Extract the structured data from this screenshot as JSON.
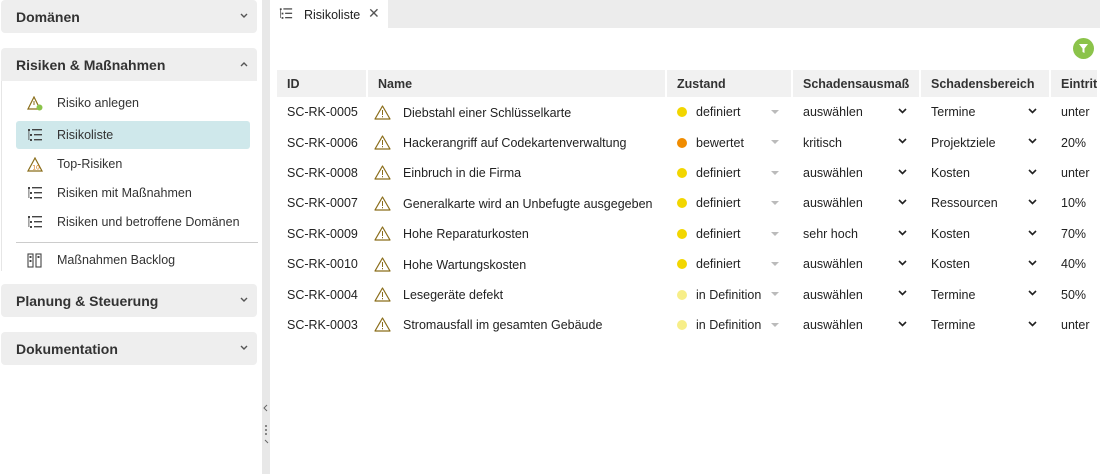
{
  "sidebar": {
    "sections": [
      {
        "label": "Domänen"
      },
      {
        "label": "Risiken & Maßnahmen"
      },
      {
        "label": "Planung & Steuerung"
      },
      {
        "label": "Dokumentation"
      }
    ],
    "items": [
      {
        "label": "Risiko anlegen",
        "icon": "risk-add-icon"
      },
      {
        "label": "Risikoliste",
        "icon": "list-icon"
      },
      {
        "label": "Top-Risiken",
        "icon": "top-risk-icon"
      },
      {
        "label": "Risiken mit Maßnahmen",
        "icon": "list-icon"
      },
      {
        "label": "Risiken und betroffene Domänen",
        "icon": "list-icon"
      },
      {
        "label": "Maßnahmen Backlog",
        "icon": "backlog-icon"
      }
    ]
  },
  "tab": {
    "label": "Risikoliste",
    "close": "✕"
  },
  "table": {
    "headers": [
      "ID",
      "Name",
      "Zustand",
      "Schadensausmaß",
      "Schadensbereich",
      "Eintrit"
    ],
    "rows": [
      {
        "id": "SC-RK-0005",
        "name": "Diebstahl einer Schlüsselkarte",
        "zustand": "definiert",
        "color": "#f2d600",
        "ausmass": "auswählen",
        "bereich": "Termine",
        "eintritt": "unter"
      },
      {
        "id": "SC-RK-0006",
        "name": "Hackerangriff auf Codekartenverwaltung",
        "zustand": "bewertet",
        "color": "#f08c00",
        "ausmass": "kritisch",
        "bereich": "Projektziele",
        "eintritt": "20%"
      },
      {
        "id": "SC-RK-0008",
        "name": "Einbruch in die Firma",
        "zustand": "definiert",
        "color": "#f2d600",
        "ausmass": "auswählen",
        "bereich": "Kosten",
        "eintritt": "unter"
      },
      {
        "id": "SC-RK-0007",
        "name": "Generalkarte wird an Unbefugte ausgegeben",
        "zustand": "definiert",
        "color": "#f2d600",
        "ausmass": "auswählen",
        "bereich": "Ressourcen",
        "eintritt": "10%"
      },
      {
        "id": "SC-RK-0009",
        "name": "Hohe Reparaturkosten",
        "zustand": "definiert",
        "color": "#f2d600",
        "ausmass": "sehr hoch",
        "bereich": "Kosten",
        "eintritt": "70%"
      },
      {
        "id": "SC-RK-0010",
        "name": "Hohe Wartungskosten",
        "zustand": "definiert",
        "color": "#f2d600",
        "ausmass": "auswählen",
        "bereich": "Kosten",
        "eintritt": "40%"
      },
      {
        "id": "SC-RK-0004",
        "name": "Lesegeräte defekt",
        "zustand": "in Definition",
        "color": "#f7ee88",
        "ausmass": "auswählen",
        "bereich": "Termine",
        "eintritt": "50%"
      },
      {
        "id": "SC-RK-0003",
        "name": "Stromausfall im gesamten Gebäude",
        "zustand": "in Definition",
        "color": "#f7ee88",
        "ausmass": "auswählen",
        "bereich": "Termine",
        "eintritt": "unter"
      }
    ]
  },
  "colors": {
    "accent_active": "#cfe8eb",
    "filter": "#8bc34a",
    "warning": "#c8a200"
  }
}
